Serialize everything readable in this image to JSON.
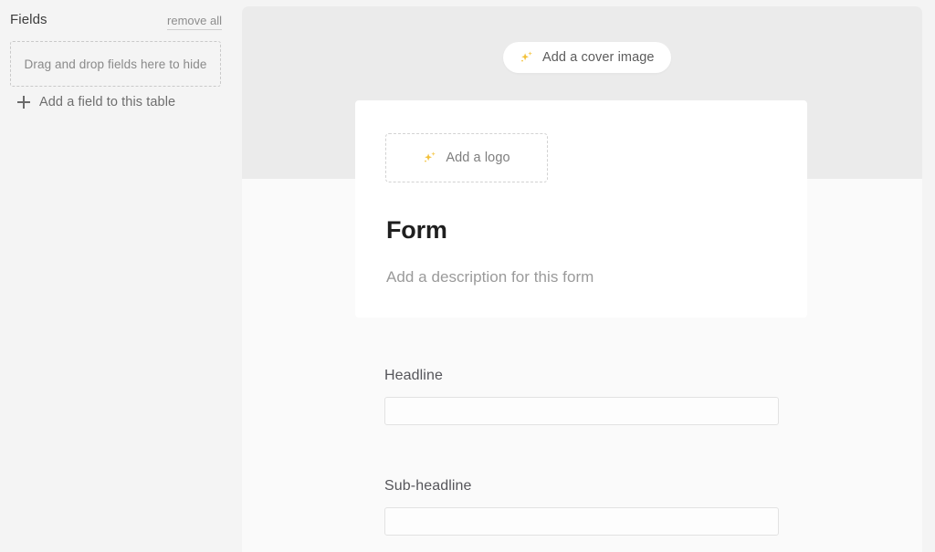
{
  "sidebar": {
    "title": "Fields",
    "remove_all_label": "remove all",
    "dropzone_label": "Drag and drop fields here to hide",
    "add_field_label": "Add a field to this table",
    "plus_icon": "plus-icon",
    "background_color": "#f4f4f4"
  },
  "main": {
    "cover": {
      "add_cover_label": "Add a cover image",
      "icon": "sparkles-icon",
      "background_color": "#ebebeb",
      "button_background": "#ffffff"
    },
    "card": {
      "add_logo_label": "Add a logo",
      "logo_icon": "sparkles-icon",
      "title": "Form",
      "description": "Add a description for this form",
      "background_color": "#ffffff"
    },
    "fields": [
      {
        "label": "Headline",
        "value": "",
        "placeholder": ""
      },
      {
        "label": "Sub-headline",
        "value": "",
        "placeholder": ""
      }
    ],
    "background_color": "#fafafa"
  },
  "colors": {
    "accent_sparkle": "#f2c040",
    "text_primary": "#1f1f1f",
    "text_muted": "#9a9a9a",
    "border_dashed": "#c9c9c9"
  }
}
